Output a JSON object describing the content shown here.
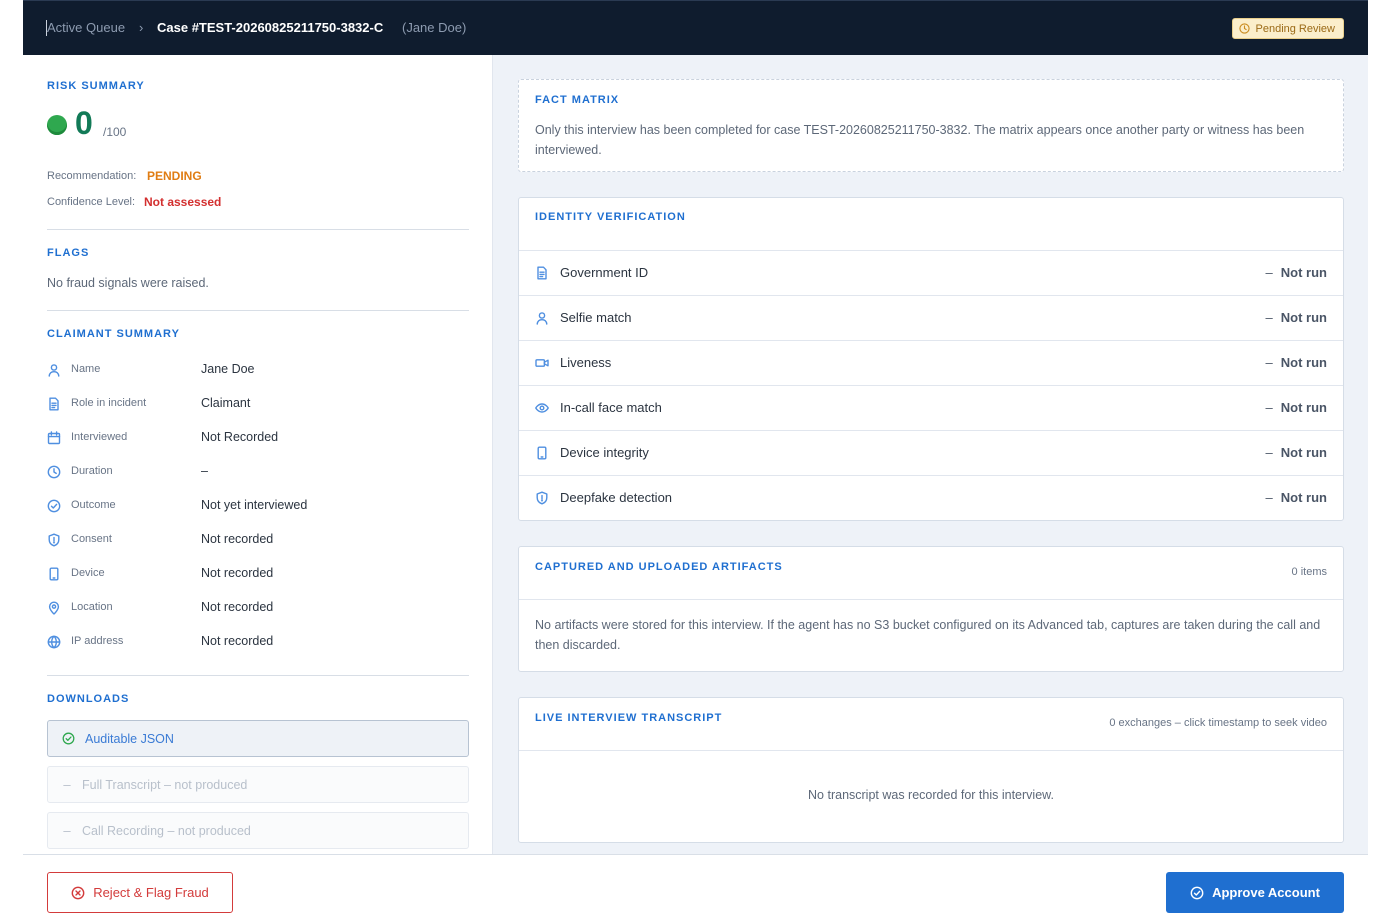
{
  "header": {
    "breadcrumb_root": "Active Queue",
    "breadcrumb_sep": "›",
    "case_id": "Case #TEST-20260825211750-3832-C",
    "case_party": "(Jane Doe)",
    "status_badge": "Pending Review"
  },
  "risk_summary": {
    "title": "RISK SUMMARY",
    "score": "0",
    "score_max": "/100",
    "recommendation_label": "Recommendation:",
    "recommendation_value": "PENDING",
    "confidence_label": "Confidence Level:",
    "confidence_value": "Not assessed",
    "score_color": "#2fa84f"
  },
  "flags": {
    "title": "FLAGS",
    "text": "No fraud signals were raised."
  },
  "claimant": {
    "title": "CLAIMANT SUMMARY",
    "rows": [
      {
        "label": "Name",
        "value": "Jane Doe",
        "icon": "user-icon"
      },
      {
        "label": "Role in incident",
        "value": "Claimant",
        "icon": "document-icon"
      },
      {
        "label": "Interviewed",
        "value": "Not Recorded",
        "icon": "calendar-icon"
      },
      {
        "label": "Duration",
        "value": "–",
        "icon": "clock-icon"
      },
      {
        "label": "Outcome",
        "value": "Not yet interviewed",
        "icon": "check-circle-icon"
      },
      {
        "label": "Consent",
        "value": "Not recorded",
        "icon": "shield-icon"
      },
      {
        "label": "Device",
        "value": "Not recorded",
        "icon": "phone-icon"
      },
      {
        "label": "Location",
        "value": "Not recorded",
        "icon": "location-pin-icon"
      },
      {
        "label": "IP address",
        "value": "Not recorded",
        "icon": "globe-icon"
      }
    ]
  },
  "downloads": {
    "title": "DOWNLOADS",
    "items": [
      {
        "label": "Auditable JSON",
        "state": "available"
      },
      {
        "label": "Full Transcript – not produced",
        "state": "disabled"
      },
      {
        "label": "Call Recording – not produced",
        "state": "disabled"
      }
    ]
  },
  "fact_matrix": {
    "title": "FACT MATRIX",
    "text": "Only this interview has been completed for case TEST-20260825211750-3832. The matrix appears once another party or witness has been interviewed."
  },
  "identity": {
    "title": "IDENTITY VERIFICATION",
    "rows": [
      {
        "label": "Government ID",
        "status": "Not run",
        "icon": "document-icon"
      },
      {
        "label": "Selfie match",
        "status": "Not run",
        "icon": "user-icon"
      },
      {
        "label": "Liveness",
        "status": "Not run",
        "icon": "video-camera-icon"
      },
      {
        "label": "In-call face match",
        "status": "Not run",
        "icon": "eye-icon"
      },
      {
        "label": "Device integrity",
        "status": "Not run",
        "icon": "phone-icon"
      },
      {
        "label": "Deepfake detection",
        "status": "Not run",
        "icon": "shield-alert-icon"
      }
    ]
  },
  "artifacts": {
    "title": "CAPTURED AND UPLOADED ARTIFACTS",
    "count": "0 items",
    "text": "No artifacts were stored for this interview. If the agent has no S3 bucket configured on its Advanced tab, captures are taken during the call and then discarded."
  },
  "transcript": {
    "title": "LIVE INTERVIEW TRANSCRIPT",
    "meta": "0 exchanges – click timestamp to seek video",
    "empty": "No transcript was recorded for this interview."
  },
  "footer": {
    "reject_label": "Reject & Flag Fraud",
    "approve_label": "Approve Account"
  },
  "colors": {
    "accent": "#1f6fd0",
    "header_bg": "#0f1c2e",
    "danger": "#d33b3b",
    "warning": "#e07d14"
  }
}
